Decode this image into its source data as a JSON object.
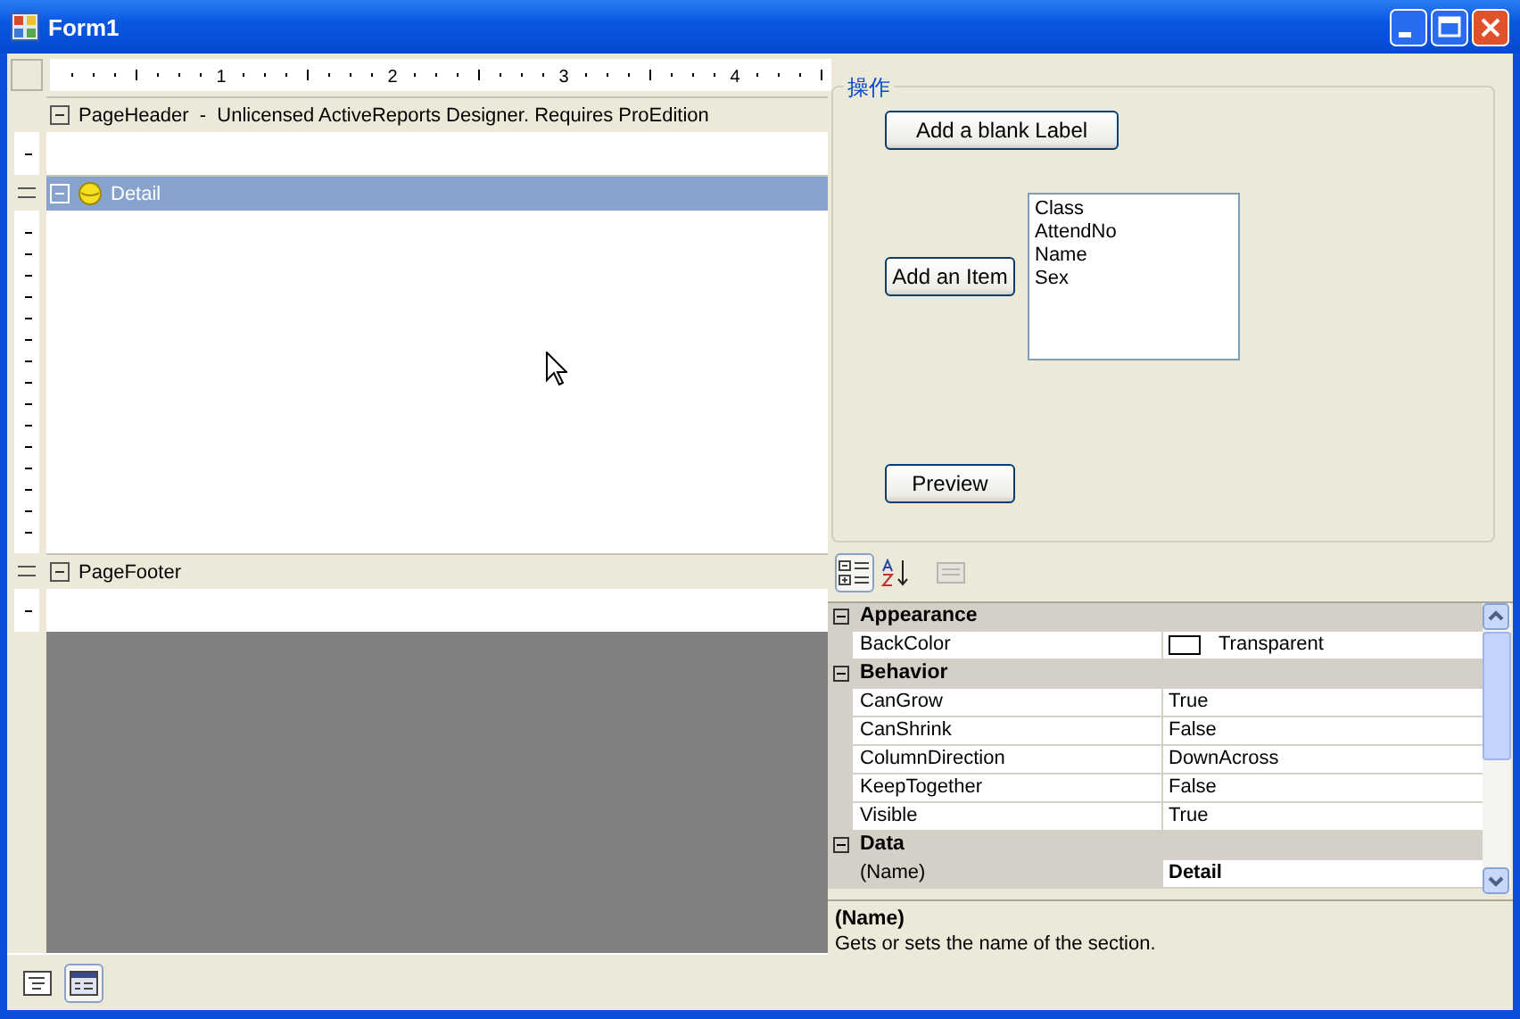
{
  "window": {
    "title": "Form1"
  },
  "designer": {
    "ruler_labels": [
      "1",
      "2",
      "3",
      "4"
    ],
    "sections": [
      {
        "kind": "page",
        "title": "PageHeader  -  Unlicensed ActiveReports Designer. Requires ProEdition",
        "selected": false
      },
      {
        "kind": "detail",
        "title": "Detail",
        "selected": true
      },
      {
        "kind": "page",
        "title": "PageFooter",
        "selected": false
      }
    ],
    "view_tabs": [
      {
        "kind": "script",
        "selected": false
      },
      {
        "kind": "layout",
        "selected": true
      }
    ]
  },
  "actions": {
    "legend": "操作",
    "add_label_button": "Add a blank Label",
    "add_item_button": "Add an Item",
    "fields_list": [
      "Class",
      "AttendNo",
      "Name",
      "Sex"
    ],
    "preview_button": "Preview"
  },
  "properties": {
    "toolbar": [
      {
        "kind": "categorized",
        "selected": true,
        "disabled": false
      },
      {
        "kind": "alphabetical",
        "selected": false,
        "disabled": false
      },
      {
        "kind": "pages",
        "selected": false,
        "disabled": true
      }
    ],
    "categories": [
      {
        "name": "Appearance",
        "expanded": true,
        "rows": [
          {
            "name": "BackColor",
            "value": "Transparent",
            "kind": "color",
            "bold": false,
            "selected": false
          }
        ]
      },
      {
        "name": "Behavior",
        "expanded": true,
        "rows": [
          {
            "name": "CanGrow",
            "value": "True",
            "bold": false,
            "selected": false
          },
          {
            "name": "CanShrink",
            "value": "False",
            "bold": false,
            "selected": false
          },
          {
            "name": "ColumnDirection",
            "value": "DownAcross",
            "bold": false,
            "selected": false
          },
          {
            "name": "KeepTogether",
            "value": "False",
            "bold": false,
            "selected": false
          },
          {
            "name": "Visible",
            "value": "True",
            "bold": false,
            "selected": false
          }
        ]
      },
      {
        "name": "Data",
        "expanded": true,
        "rows": [
          {
            "name": "(Name)",
            "value": "Detail",
            "bold": true,
            "selected": true
          }
        ]
      }
    ],
    "description": {
      "title": "(Name)",
      "text": "Gets or sets the name of the section."
    }
  }
}
